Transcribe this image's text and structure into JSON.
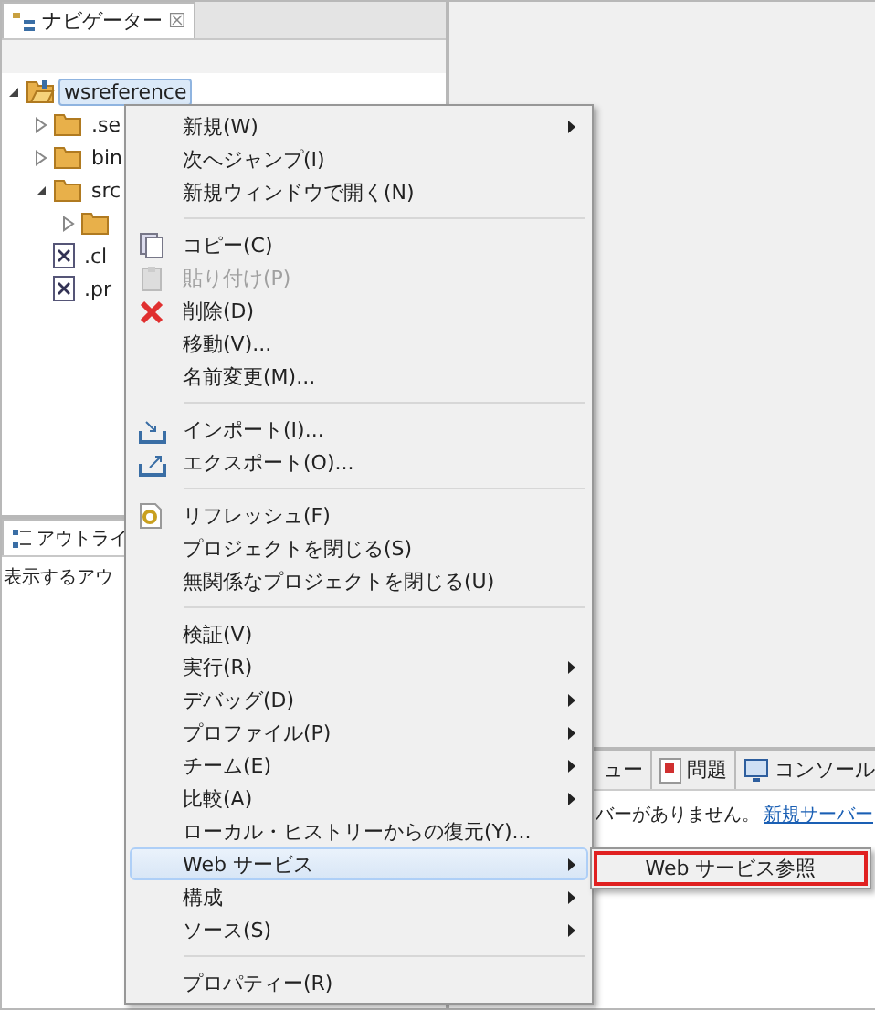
{
  "navigator": {
    "title": "ナビゲーター",
    "close": "☒",
    "tree": [
      {
        "label": "wsreference",
        "kind": "project",
        "expanded": true,
        "selected": true,
        "children": [
          {
            "label": ".se",
            "kind": "folder",
            "expanded": false,
            "selected": false
          },
          {
            "label": "bin",
            "kind": "folder",
            "expanded": false,
            "selected": false
          },
          {
            "label": "src",
            "kind": "folder",
            "expanded": true,
            "selected": false,
            "children": [
              {
                "kind": "folder",
                "expanded": false
              }
            ]
          },
          {
            "label": ".cl",
            "kind": "file",
            "selected": false
          },
          {
            "label": ".pr",
            "kind": "file",
            "selected": false
          }
        ]
      }
    ]
  },
  "outline": {
    "title": "アウトライ",
    "message": "表示するアウ"
  },
  "bottom_panel": {
    "tabs": [
      {
        "label": "ュー",
        "kind": "plain",
        "selected": false
      },
      {
        "label": "問題",
        "kind": "problems",
        "selected": false
      },
      {
        "label": "コンソール",
        "kind": "console",
        "selected": false
      }
    ],
    "message": "バーがありません。",
    "link": "新規サーバー"
  },
  "context_menu": {
    "items": [
      {
        "label": "新規(W)",
        "submenu": true
      },
      {
        "label": "次へジャンプ(I)"
      },
      {
        "label": "新規ウィンドウで開く(N)"
      },
      {
        "kind": "separator"
      },
      {
        "label": "コピー(C)",
        "kind": "copy"
      },
      {
        "label": "貼り付け(P)",
        "kind": "paste",
        "disabled": true
      },
      {
        "label": "削除(D)",
        "kind": "delete"
      },
      {
        "label": "移動(V)..."
      },
      {
        "label": "名前変更(M)..."
      },
      {
        "kind": "separator"
      },
      {
        "label": "インポート(I)...",
        "kind": "import"
      },
      {
        "label": "エクスポート(O)...",
        "kind": "export"
      },
      {
        "kind": "separator"
      },
      {
        "label": "リフレッシュ(F)",
        "kind": "refresh"
      },
      {
        "label": "プロジェクトを閉じる(S)"
      },
      {
        "label": "無関係なプロジェクトを閉じる(U)"
      },
      {
        "kind": "separator"
      },
      {
        "label": "検証(V)"
      },
      {
        "label": "実行(R)",
        "submenu": true
      },
      {
        "label": "デバッグ(D)",
        "submenu": true
      },
      {
        "label": "プロファイル(P)",
        "submenu": true
      },
      {
        "label": "チーム(E)",
        "submenu": true
      },
      {
        "label": "比較(A)",
        "submenu": true
      },
      {
        "label": "ローカル・ヒストリーからの復元(Y)..."
      },
      {
        "label": "Web サービス",
        "submenu": true,
        "selected": true
      },
      {
        "label": "構成",
        "submenu": true
      },
      {
        "label": "ソース(S)",
        "submenu": true
      },
      {
        "kind": "separator"
      },
      {
        "label": "プロパティー(R)"
      }
    ]
  },
  "submenu": {
    "items": [
      {
        "label": "Web サービス参照",
        "highlighted": true
      }
    ]
  }
}
